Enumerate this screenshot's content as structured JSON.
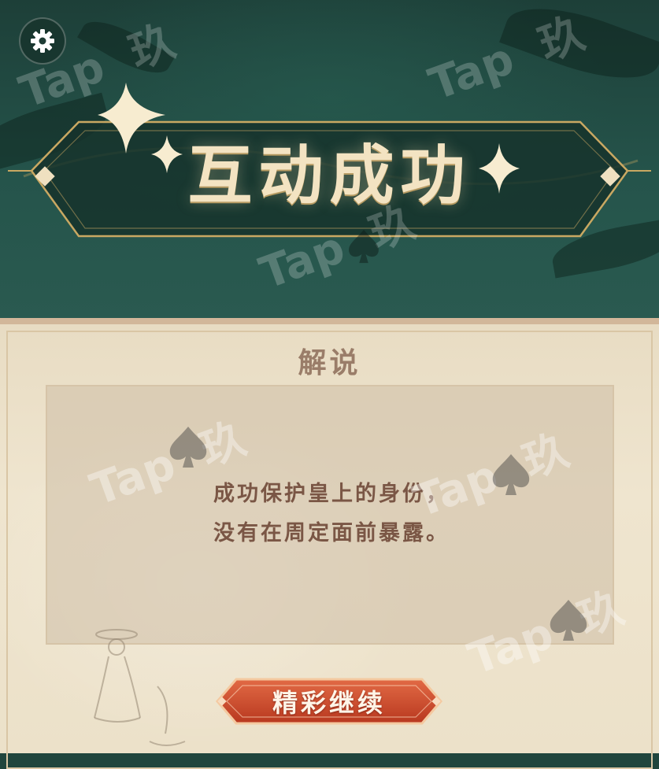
{
  "banner": {
    "title": "互动成功"
  },
  "panel": {
    "heading": "解说",
    "lines": [
      "成功保护皇上的身份，",
      "没有在周定面前暴露。"
    ]
  },
  "actions": {
    "continue_label": "精彩继续"
  },
  "watermark": {
    "text": "Tap",
    "char": "玖"
  },
  "icons": {
    "settings": "gear-icon",
    "watermark_mark": "spade-icon"
  },
  "colors": {
    "banner_bg": "#20453d",
    "gold": "#c9a862",
    "title_text": "#f3e3c2",
    "parchment": "#ece1c9",
    "body_text": "#7a5645",
    "button_red": "#c8452a"
  }
}
